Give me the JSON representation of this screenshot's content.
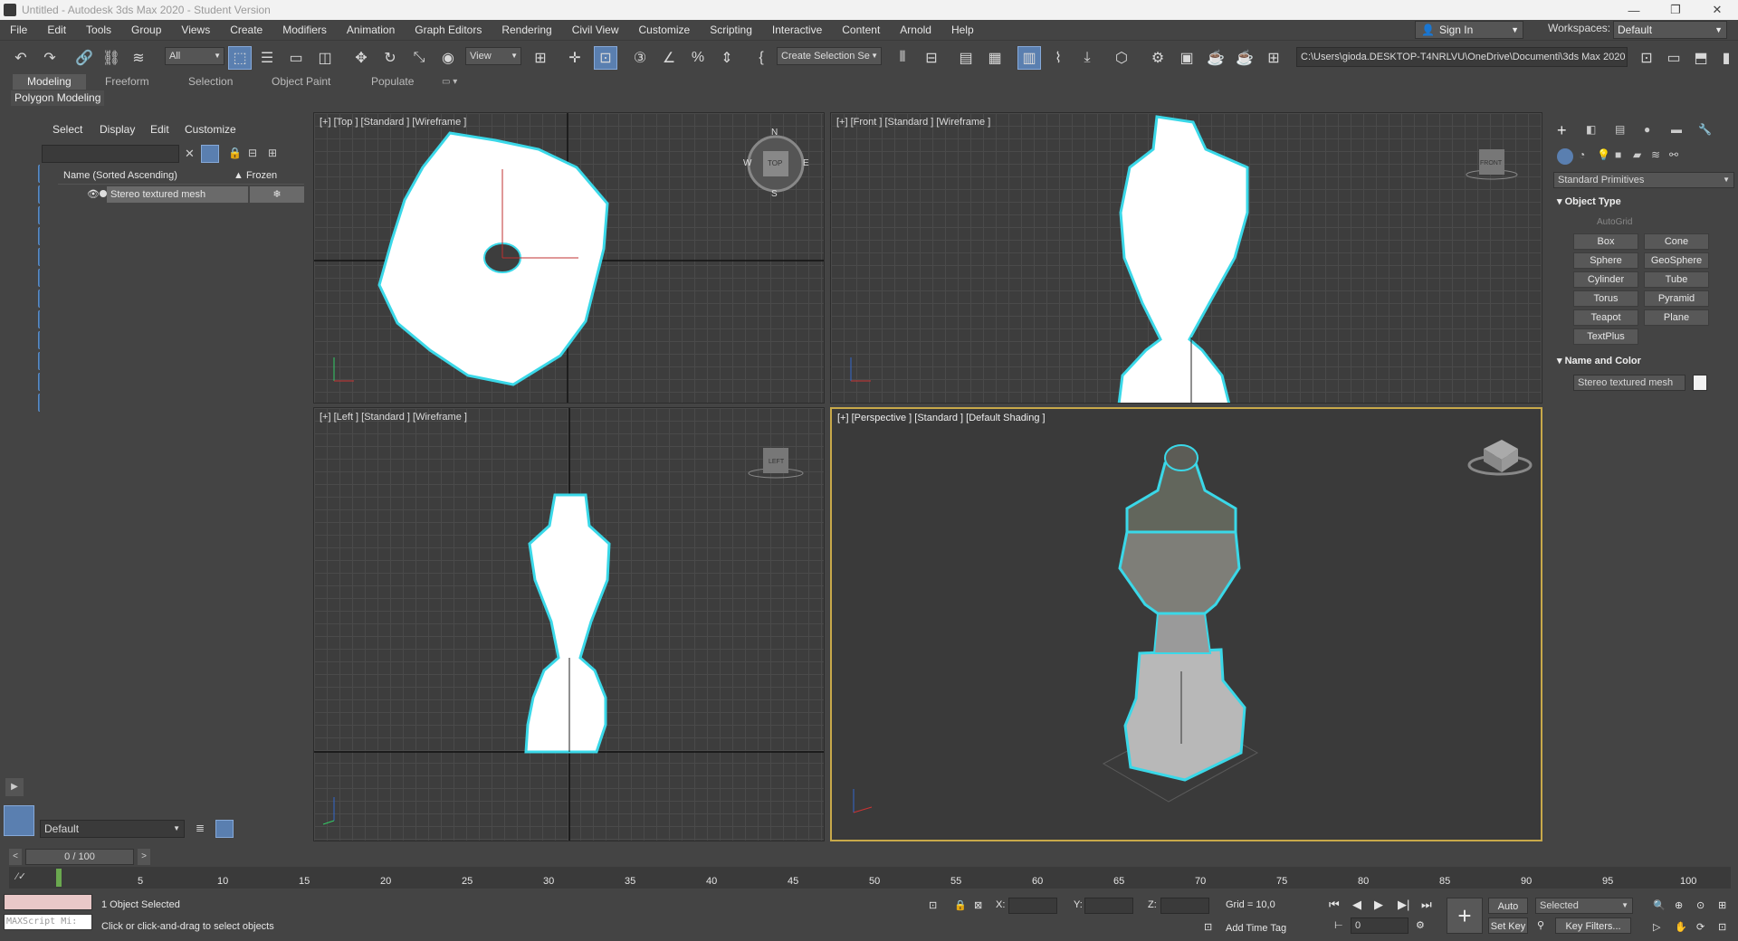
{
  "window": {
    "title": "Untitled - Autodesk 3ds Max 2020 - Student Version",
    "controls": [
      "—",
      "❐",
      "✕"
    ]
  },
  "menu": [
    "File",
    "Edit",
    "Tools",
    "Group",
    "Views",
    "Create",
    "Modifiers",
    "Animation",
    "Graph Editors",
    "Rendering",
    "Civil View",
    "Customize",
    "Scripting",
    "Interactive",
    "Content",
    "Arnold",
    "Help"
  ],
  "account": {
    "signin": "Sign In",
    "workspaces_label": "Workspaces:",
    "workspace": "Default"
  },
  "toolbar": {
    "filter": "All",
    "refcoord": "View",
    "selection_set": "Create Selection Se",
    "path": "C:\\Users\\gioda.DESKTOP-T4NRLVU\\OneDrive\\Documenti\\3ds Max 2020"
  },
  "ribbon": {
    "tabs": [
      "Modeling",
      "Freeform",
      "Selection",
      "Object Paint",
      "Populate"
    ],
    "active": "Modeling",
    "panel": "Polygon Modeling"
  },
  "explorer": {
    "menu": [
      "Select",
      "Display",
      "Edit",
      "Customize"
    ],
    "col_name": "Name (Sorted Ascending)",
    "col_frozen": "▲ Frozen",
    "objects": [
      "Stereo textured mesh"
    ]
  },
  "viewports": {
    "top": "[+] [Top ] [Standard ] [Wireframe ]",
    "front": "[+] [Front ] [Standard ] [Wireframe ]",
    "left": "[+] [Left ] [Standard ] [Wireframe ]",
    "persp": "[+] [Perspective ] [Standard ] [Default Shading ]",
    "cube_top": "TOP",
    "cube_front": "FRONT",
    "cube_left": "LEFT",
    "compass": {
      "n": "N",
      "s": "S",
      "e": "E",
      "w": "W"
    }
  },
  "cmdpanel": {
    "category": "Standard Primitives",
    "rollout_object_type": "Object Type",
    "autogrid": "AutoGrid",
    "buttons": [
      "Box",
      "Cone",
      "Sphere",
      "GeoSphere",
      "Cylinder",
      "Tube",
      "Torus",
      "Pyramid",
      "Teapot",
      "Plane",
      "TextPlus"
    ],
    "rollout_name_color": "Name and Color",
    "object_name": "Stereo textured mesh"
  },
  "layer": {
    "name": "Default"
  },
  "time": {
    "counter": "0 / 100",
    "ticks": [
      "5",
      "10",
      "15",
      "20",
      "25",
      "30",
      "35",
      "40",
      "45",
      "50",
      "55",
      "60",
      "65",
      "70",
      "75",
      "80",
      "85",
      "90",
      "95",
      "100"
    ]
  },
  "status": {
    "maxscript": "MAXScript Mi:",
    "selected": "1 Object Selected",
    "prompt": "Click or click-and-drag to select objects",
    "x_label": "X:",
    "y_label": "Y:",
    "z_label": "Z:",
    "grid": "Grid = 10,0",
    "add_time_tag": "Add Time Tag",
    "auto_key": "Auto Key",
    "set_key": "Set Key",
    "selected_mode": "Selected",
    "key_filters": "Key Filters...",
    "frame": "0"
  }
}
